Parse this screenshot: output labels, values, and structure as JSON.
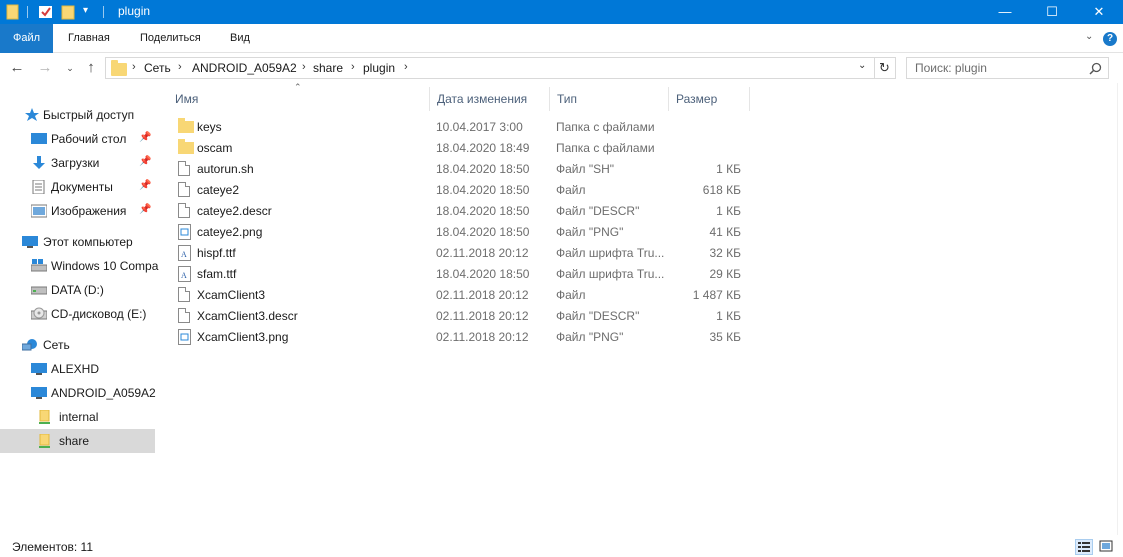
{
  "window": {
    "title": "plugin"
  },
  "ribbon": {
    "tabs": [
      "Файл",
      "Главная",
      "Поделиться",
      "Вид"
    ]
  },
  "address": {
    "crumbs": [
      "Сеть",
      "ANDROID_A059A2",
      "share",
      "plugin"
    ]
  },
  "search": {
    "placeholder": "Поиск: plugin"
  },
  "sidebar": {
    "items": [
      {
        "label": "Быстрый доступ",
        "icon": "star-icon",
        "pinned": false
      },
      {
        "label": "Рабочий стол",
        "icon": "desktop-icon",
        "pinned": true
      },
      {
        "label": "Загрузки",
        "icon": "download-icon",
        "pinned": true
      },
      {
        "label": "Документы",
        "icon": "documents-icon",
        "pinned": true
      },
      {
        "label": "Изображения",
        "icon": "pictures-icon",
        "pinned": true
      },
      {
        "label": "Этот компьютер",
        "icon": "computer-icon",
        "pinned": false
      },
      {
        "label": "Windows 10 Compa",
        "icon": "windows-drive-icon",
        "pinned": false
      },
      {
        "label": "DATA (D:)",
        "icon": "drive-icon",
        "pinned": false
      },
      {
        "label": "CD-дисковод (E:)",
        "icon": "cd-drive-icon",
        "pinned": false
      },
      {
        "label": "Сеть",
        "icon": "network-icon",
        "pinned": false
      },
      {
        "label": "ALEXHD",
        "icon": "computer-icon",
        "pinned": false
      },
      {
        "label": "ANDROID_A059A2",
        "icon": "computer-icon",
        "pinned": false
      },
      {
        "label": "internal",
        "icon": "share-folder-icon",
        "pinned": false
      },
      {
        "label": "share",
        "icon": "share-folder-icon",
        "pinned": false
      }
    ]
  },
  "columns": [
    "Имя",
    "Дата изменения",
    "Тип",
    "Размер"
  ],
  "files": [
    {
      "name": "keys",
      "date": "10.04.2017 3:00",
      "type": "Папка с файлами",
      "size": "",
      "icon": "folder-icon"
    },
    {
      "name": "oscam",
      "date": "18.04.2020 18:49",
      "type": "Папка с файлами",
      "size": "",
      "icon": "folder-icon"
    },
    {
      "name": "autorun.sh",
      "date": "18.04.2020 18:50",
      "type": "Файл \"SH\"",
      "size": "1 КБ",
      "icon": "file-icon"
    },
    {
      "name": "cateye2",
      "date": "18.04.2020 18:50",
      "type": "Файл",
      "size": "618 КБ",
      "icon": "file-icon"
    },
    {
      "name": "cateye2.descr",
      "date": "18.04.2020 18:50",
      "type": "Файл \"DESCR\"",
      "size": "1 КБ",
      "icon": "file-icon"
    },
    {
      "name": "cateye2.png",
      "date": "18.04.2020 18:50",
      "type": "Файл \"PNG\"",
      "size": "41 КБ",
      "icon": "image-file-icon"
    },
    {
      "name": "hispf.ttf",
      "date": "02.11.2018 20:12",
      "type": "Файл шрифта Tru...",
      "size": "32 КБ",
      "icon": "font-file-icon"
    },
    {
      "name": "sfam.ttf",
      "date": "18.04.2020 18:50",
      "type": "Файл шрифта Tru...",
      "size": "29 КБ",
      "icon": "font-file-icon"
    },
    {
      "name": "XcamClient3",
      "date": "02.11.2018 20:12",
      "type": "Файл",
      "size": "1 487 КБ",
      "icon": "file-icon"
    },
    {
      "name": "XcamClient3.descr",
      "date": "02.11.2018 20:12",
      "type": "Файл \"DESCR\"",
      "size": "1 КБ",
      "icon": "file-icon"
    },
    {
      "name": "XcamClient3.png",
      "date": "02.11.2018 20:12",
      "type": "Файл \"PNG\"",
      "size": "35 КБ",
      "icon": "image-file-icon"
    }
  ],
  "status": {
    "text": "Элементов: 11"
  },
  "colors": {
    "titlebar": "#0078d7",
    "file_tab": "#1979ca",
    "selected_nav": "#d9d9d9",
    "folder": "#f8d775"
  }
}
